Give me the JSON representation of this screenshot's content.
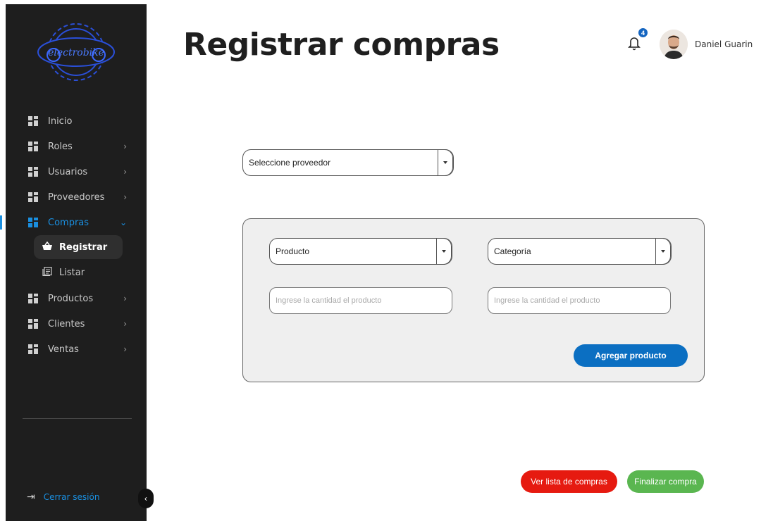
{
  "page": {
    "title": "Registrar compras"
  },
  "header": {
    "notification_count": "4",
    "user_name": "Daniel Guarin",
    "icons": {
      "notifications": "bell-icon",
      "avatar": "user-avatar"
    }
  },
  "sidebar": {
    "logo_text": "electrobike",
    "items": [
      {
        "label": "Inicio",
        "icon": "grid-icon",
        "has_chevron": false
      },
      {
        "label": "Roles",
        "icon": "grid-icon",
        "has_chevron": true
      },
      {
        "label": "Usuarios",
        "icon": "grid-icon",
        "has_chevron": true
      },
      {
        "label": "Proveedores",
        "icon": "grid-icon",
        "has_chevron": true
      },
      {
        "label": "Compras",
        "icon": "grid-icon",
        "has_chevron": true,
        "active": true,
        "children": [
          {
            "label": "Registrar",
            "icon": "basket-icon",
            "selected": true
          },
          {
            "label": "Listar",
            "icon": "list-icon",
            "selected": false
          }
        ]
      },
      {
        "label": "Productos",
        "icon": "grid-icon",
        "has_chevron": true
      },
      {
        "label": "Clientes",
        "icon": "grid-icon",
        "has_chevron": true
      },
      {
        "label": "Ventas",
        "icon": "grid-icon",
        "has_chevron": true
      }
    ],
    "logout_label": "Cerrar sesión",
    "accent_color": "#1a8fe0"
  },
  "form": {
    "supplier_select": "Seleccione proveedor",
    "product_select": "Producto",
    "category_select": "Categoría",
    "quantity_placeholder_left": "Ingrese la cantidad el producto",
    "quantity_placeholder_right": "Ingrese la cantidad el producto",
    "add_button": "Agregar producto"
  },
  "footer_actions": {
    "view_list_button": "Ver lista de compras",
    "finish_button": "Finalizar compra"
  },
  "colors": {
    "primary_blue": "#0b6fc2",
    "danger_red": "#e61a10",
    "success_green": "#5ab650",
    "sidebar_bg": "#1e1e1e"
  }
}
